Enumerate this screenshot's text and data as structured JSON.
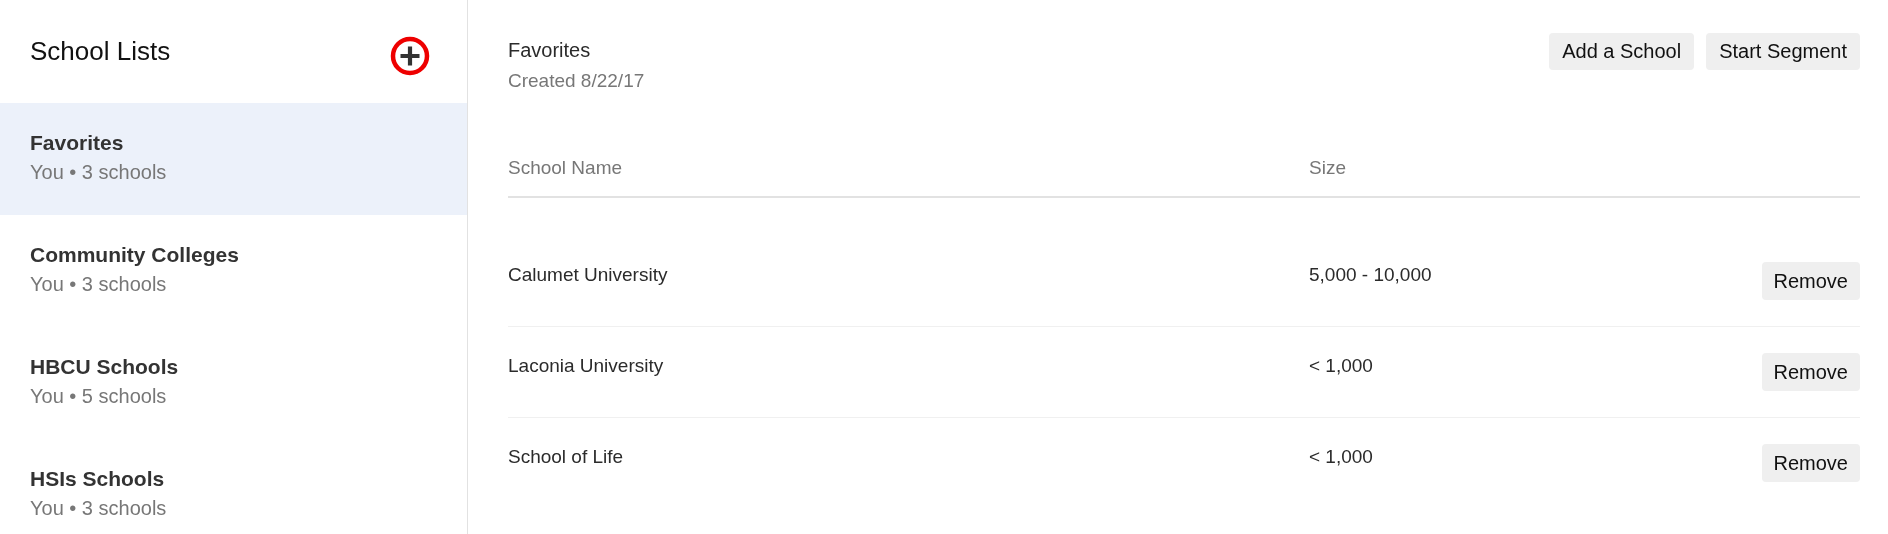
{
  "sidebar": {
    "title": "School Lists",
    "items": [
      {
        "name": "Favorites",
        "meta": "You • 3 schools",
        "selected": true
      },
      {
        "name": "Community Colleges",
        "meta": "You • 3 schools",
        "selected": false
      },
      {
        "name": "HBCU Schools",
        "meta": "You • 5 schools",
        "selected": false
      },
      {
        "name": "HSIs Schools",
        "meta": "You • 3 schools",
        "selected": false
      }
    ]
  },
  "list": {
    "title": "Favorites",
    "created": "Created 8/22/17",
    "buttons": [
      "Add a School",
      "Start Segment"
    ]
  },
  "table": {
    "columns": [
      "School Name",
      "Size"
    ],
    "rows": [
      {
        "name": "Calumet University",
        "size": "5,000 - 10,000",
        "action": "Remove"
      },
      {
        "name": "Laconia University",
        "size": "< 1,000",
        "action": "Remove"
      },
      {
        "name": "School of Life",
        "size": "< 1,000",
        "action": "Remove"
      }
    ]
  }
}
